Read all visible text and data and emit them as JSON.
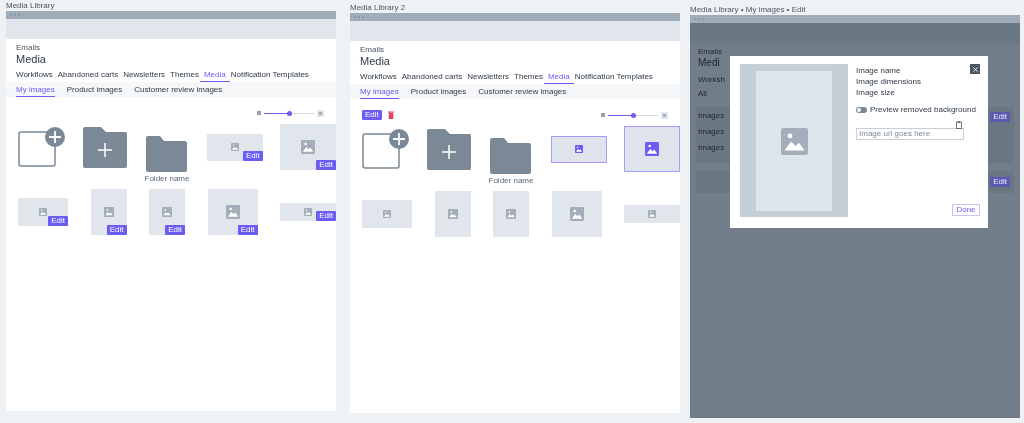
{
  "frames": [
    {
      "label": "Media Library",
      "kind": "library",
      "breadcrumb": "Emails",
      "title": "Media",
      "tabs": [
        {
          "label": "Workflows",
          "selected": false
        },
        {
          "label": "Abandoned carts",
          "selected": false
        },
        {
          "label": "Newsletters",
          "selected": false
        },
        {
          "label": "Themes",
          "selected": false
        },
        {
          "label": "Media",
          "selected": true
        },
        {
          "label": "Notification Templates",
          "selected": false
        }
      ],
      "subtabs": [
        {
          "label": "My images",
          "selected": true
        },
        {
          "label": "Product images",
          "selected": false
        },
        {
          "label": "Customer review images",
          "selected": false
        }
      ],
      "slider": {
        "level": 0.5
      },
      "rows": [
        {
          "items": [
            {
              "kind": "new-image"
            },
            {
              "kind": "new-folder"
            },
            {
              "kind": "folder",
              "label": "Folder name"
            },
            {
              "kind": "image-wide",
              "edit": "Edit",
              "selected": false
            },
            {
              "kind": "image-large",
              "edit": "Edit",
              "selected": false
            }
          ]
        },
        {
          "items": [
            {
              "kind": "image-landscape",
              "edit": "Edit",
              "selected": false
            },
            {
              "kind": "image-portrait",
              "edit": "Edit",
              "selected": false
            },
            {
              "kind": "image-portrait",
              "edit": "Edit",
              "selected": false
            },
            {
              "kind": "image-square",
              "edit": "Edit",
              "selected": false
            },
            {
              "kind": "image-strip",
              "edit": "Edit",
              "selected": false
            }
          ]
        }
      ]
    },
    {
      "label": "Media Library 2",
      "kind": "library",
      "breadcrumb": "Emails",
      "title": "Media",
      "tabs": [
        {
          "label": "Workflows",
          "selected": false
        },
        {
          "label": "Abandoned carts",
          "selected": false
        },
        {
          "label": "Newsletters",
          "selected": false
        },
        {
          "label": "Themes",
          "selected": false
        },
        {
          "label": "Media",
          "selected": true
        },
        {
          "label": "Notification Templates",
          "selected": false
        }
      ],
      "subtabs": [
        {
          "label": "My images",
          "selected": true
        },
        {
          "label": "Product images",
          "selected": false
        },
        {
          "label": "Customer review images",
          "selected": false
        }
      ],
      "toolbar": {
        "edit_button": "Edit"
      },
      "slider": {
        "level": 0.5
      },
      "rows": [
        {
          "items": [
            {
              "kind": "new-image"
            },
            {
              "kind": "new-folder"
            },
            {
              "kind": "folder",
              "label": "Folder name"
            },
            {
              "kind": "image-wide",
              "selected": true
            },
            {
              "kind": "image-large",
              "selected": true
            }
          ]
        },
        {
          "items": [
            {
              "kind": "image-landscape",
              "selected": false
            },
            {
              "kind": "image-portrait",
              "selected": false
            },
            {
              "kind": "image-portrait",
              "selected": false
            },
            {
              "kind": "image-square",
              "selected": false
            },
            {
              "kind": "image-strip",
              "selected": false
            }
          ]
        }
      ]
    },
    {
      "label": "Media Library • My images • Edit",
      "kind": "editor",
      "breadcrumb": "Emails",
      "title": "Medi",
      "tab": "Worksh",
      "filter": "All",
      "rows": [
        "Images",
        "Images",
        "Images"
      ],
      "edit_buttons": [
        "Edit",
        "Edit"
      ],
      "modal": {
        "fields": [
          "Image name",
          "Image dimensions",
          "Image size"
        ],
        "toggle": {
          "label": "Preview removed background",
          "on": false
        },
        "url_field": {
          "placeholder": "Image url goes here"
        },
        "done": "Done"
      }
    }
  ]
}
